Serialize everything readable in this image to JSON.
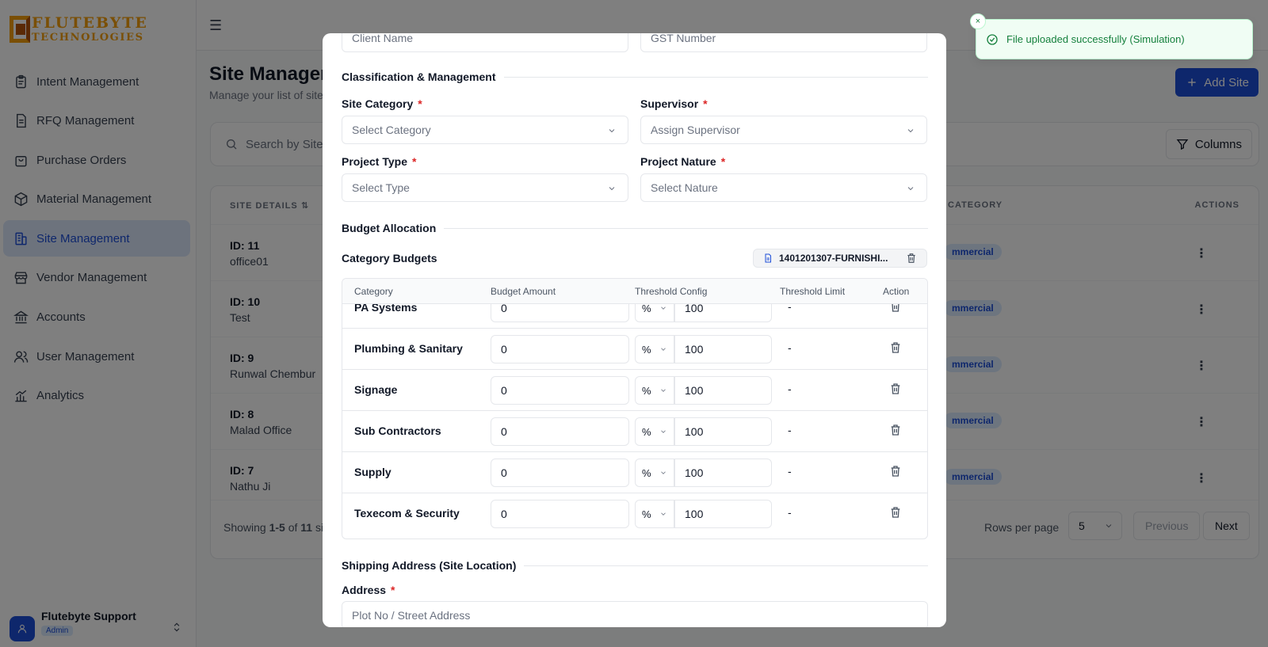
{
  "logo": {
    "line1": "FLUTEBYTE",
    "line2": "TECHNOLOGIES"
  },
  "sidebar": {
    "items": [
      {
        "label": "Intent Management",
        "icon": "clipboard-icon"
      },
      {
        "label": "RFQ Management",
        "icon": "document-icon"
      },
      {
        "label": "Purchase Orders",
        "icon": "shopping-bag-icon"
      },
      {
        "label": "Material Management",
        "icon": "box-icon"
      },
      {
        "label": "Site Management",
        "icon": "building-icon",
        "active": true
      },
      {
        "label": "Vendor Management",
        "icon": "store-icon"
      },
      {
        "label": "Accounts",
        "icon": "bank-icon"
      },
      {
        "label": "User Management",
        "icon": "users-icon"
      },
      {
        "label": "Analytics",
        "icon": "chart-icon"
      }
    ],
    "user": {
      "name": "Flutebyte Support",
      "role": "Admin"
    }
  },
  "page": {
    "title": "Site Management",
    "subtitle": "Manage your list of sites",
    "add_label": "Add Site",
    "search_placeholder": "Search by Site N",
    "columns_label": "Columns"
  },
  "table": {
    "headers": {
      "site_details": "SITE DETAILS",
      "category": "CATEGORY",
      "actions": "ACTIONS"
    },
    "rows": [
      {
        "id": "ID: 11",
        "name": "office01",
        "category": "mmercial"
      },
      {
        "id": "ID: 10",
        "name": "Test",
        "category": "mmercial"
      },
      {
        "id": "ID: 9",
        "name": "Runwal Chembur",
        "category": "mmercial"
      },
      {
        "id": "ID: 8",
        "name": "Malad Office",
        "category": "mmercial"
      },
      {
        "id": "ID: 7",
        "name": "Nathu Ji",
        "category": "mmercial"
      }
    ],
    "footer": {
      "showing_prefix": "Showing",
      "range": "1-5",
      "of": "of",
      "total": "11",
      "suffix": "si",
      "rows_per_page_label": "Rows per page",
      "rows_per_page": "5",
      "previous": "Previous",
      "next": "Next"
    }
  },
  "modal": {
    "client_name_placeholder": "Client Name",
    "gst_placeholder": "GST Number",
    "section_classification": "Classification & Management",
    "site_category_label": "Site Category",
    "site_category_placeholder": "Select Category",
    "supervisor_label": "Supervisor",
    "supervisor_placeholder": "Assign Supervisor",
    "project_type_label": "Project Type",
    "project_type_placeholder": "Select Type",
    "project_nature_label": "Project Nature",
    "project_nature_placeholder": "Select Nature",
    "section_budget": "Budget Allocation",
    "category_budgets_label": "Category Budgets",
    "uploaded_file": "1401201307-FURNISHI...",
    "budget_headers": {
      "category": "Category",
      "amount": "Budget Amount",
      "threshold": "Threshold Config",
      "limit": "Threshold Limit",
      "action": "Action"
    },
    "budget_rows": [
      {
        "category": "PA Systems",
        "amount": "0",
        "unit": "%",
        "threshold": "100",
        "limit": "-"
      },
      {
        "category": "Plumbing & Sanitary",
        "amount": "0",
        "unit": "%",
        "threshold": "100",
        "limit": "-"
      },
      {
        "category": "Signage",
        "amount": "0",
        "unit": "%",
        "threshold": "100",
        "limit": "-"
      },
      {
        "category": "Sub Contractors",
        "amount": "0",
        "unit": "%",
        "threshold": "100",
        "limit": "-"
      },
      {
        "category": "Supply",
        "amount": "0",
        "unit": "%",
        "threshold": "100",
        "limit": "-"
      },
      {
        "category": "Texecom & Security",
        "amount": "0",
        "unit": "%",
        "threshold": "100",
        "limit": "-"
      }
    ],
    "section_shipping": "Shipping Address (Site Location)",
    "address_label": "Address",
    "address_placeholder": "Plot No / Street Address"
  },
  "toast": {
    "message": "File uploaded successfully (Simulation)",
    "close": "×"
  },
  "colors": {
    "accent": "#1d4ed8",
    "logo": "#f59e0b",
    "success": "#15803d",
    "required": "#dc2626"
  }
}
